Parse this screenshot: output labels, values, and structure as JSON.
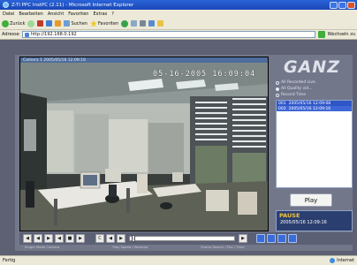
{
  "window": {
    "title": "Z-Ti PPC InstPC (2.11) - Microsoft Internet Explorer"
  },
  "menu": [
    "Datei",
    "Bearbeiten",
    "Ansicht",
    "Favoriten",
    "Extras",
    "?"
  ],
  "toolbar": {
    "back_label": "Zurück",
    "search_label": "Suchen",
    "favorites_label": "Favoriten"
  },
  "address": {
    "label": "Adresse",
    "value": "http://192.168.0.192",
    "links_label": "Wechseln zu"
  },
  "video": {
    "header": "Camera 1 2005/05/16 12:09:16",
    "osd": "05-16-2005 16:09:04"
  },
  "brand": {
    "logo": "GANZ"
  },
  "options": [
    {
      "label": "All Recorded Live",
      "selected": false
    },
    {
      "label": "All Quality vid...",
      "selected": true
    },
    {
      "label": "Record Time",
      "selected": false
    }
  ],
  "recordings": [
    {
      "id": "001",
      "time": "2005/05/16 12:09:08",
      "style": "sel"
    },
    {
      "id": "002",
      "time": "2005/05/16 12:09:16",
      "style": "alt"
    }
  ],
  "play_button": "Play",
  "playback": {
    "state": "PAUSE",
    "datetime": "2005/05/16 12:09:16"
  },
  "controls": {
    "c_label": "C",
    "labels": [
      "Single Mode Camera",
      "Play Speed / Reverse",
      "Frame Search / Pos / Time"
    ]
  },
  "status": {
    "left": "Fertig",
    "zone": "Internet"
  }
}
